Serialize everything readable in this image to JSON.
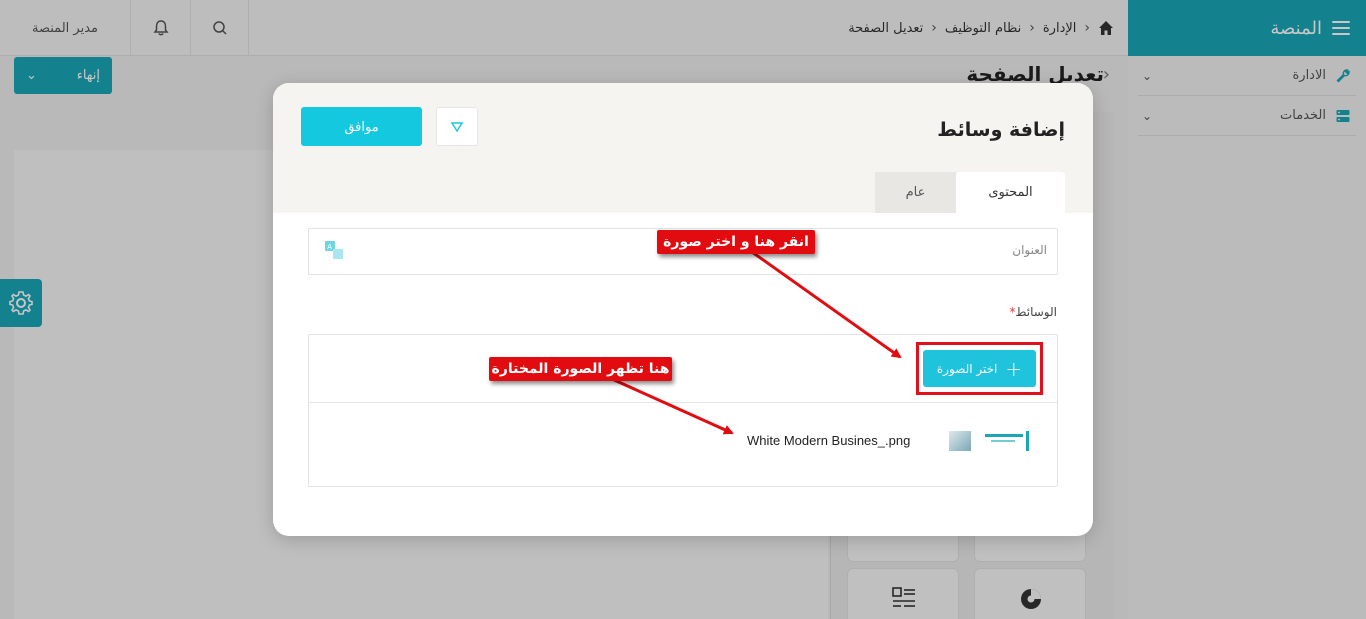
{
  "sidebar": {
    "title": "المنصة",
    "items": [
      {
        "label": "الادارة",
        "icon": "wrench-icon"
      },
      {
        "label": "الخدمات",
        "icon": "server-icon"
      }
    ]
  },
  "topbar": {
    "breadcrumb": [
      "الإدارة",
      "نظام التوظيف",
      "تعديل الصفحة"
    ],
    "user": "مدير المنصة",
    "icons": [
      "home-icon",
      "bell-icon",
      "search-icon"
    ]
  },
  "page": {
    "title": "تعديل الصفحة",
    "finish_label": "إنهاء"
  },
  "modal": {
    "title": "إضافة وسائط",
    "ok_label": "موافق",
    "tabs": [
      {
        "label": "المحتوى",
        "active": true
      },
      {
        "label": "عام",
        "active": false
      }
    ],
    "title_field": {
      "placeholder": "العنوان",
      "value": ""
    },
    "media_label": "الوسائط",
    "required_mark": "*",
    "choose_label": "اختر الصورة",
    "file_name": "White Modern Busines_.png"
  },
  "annotations": {
    "callout_1": "انقر هنا و اختر صورة",
    "callout_2": "هنا تظهر الصورة المختارة"
  },
  "colors": {
    "accent": "#1aa6b7",
    "button": "#14c8e0",
    "callout": "#e20c10"
  }
}
